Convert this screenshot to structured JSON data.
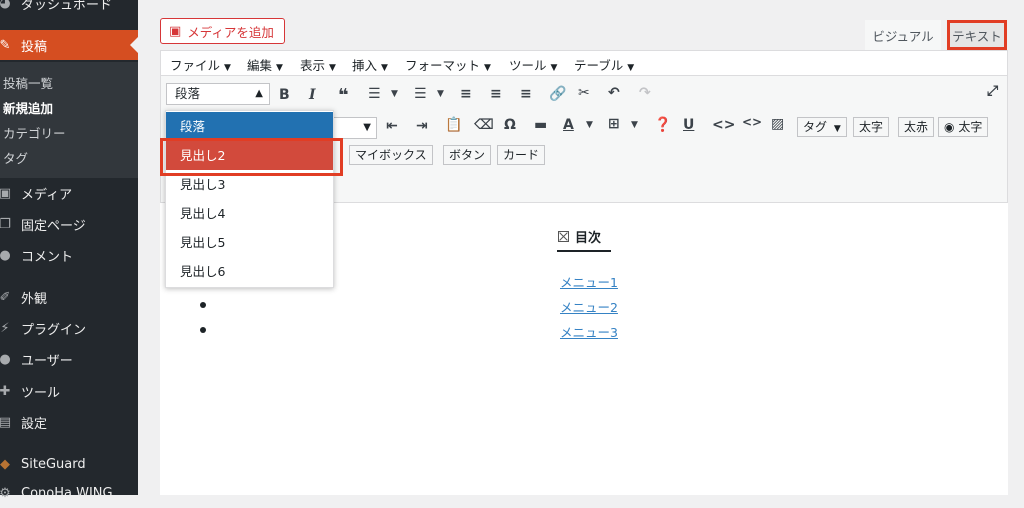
{
  "sidebar": {
    "items": [
      {
        "label": "ダッシュボード",
        "icon": "dashboard-icon"
      },
      {
        "label": "投稿",
        "icon": "pin-icon"
      },
      {
        "label": "メディア",
        "icon": "media-icon"
      },
      {
        "label": "固定ページ",
        "icon": "pages-icon"
      },
      {
        "label": "コメント",
        "icon": "comment-icon"
      },
      {
        "label": "外観",
        "icon": "brush-icon"
      },
      {
        "label": "プラグイン",
        "icon": "plugin-icon"
      },
      {
        "label": "ユーザー",
        "icon": "user-icon"
      },
      {
        "label": "ツール",
        "icon": "wrench-icon"
      },
      {
        "label": "設定",
        "icon": "settings-icon"
      },
      {
        "label": "SiteGuard",
        "icon": "shield-icon"
      },
      {
        "label": "ConoHa WING",
        "icon": "gear-icon"
      }
    ],
    "submenu": [
      "投稿一覧",
      "新規追加",
      "カテゴリー",
      "タグ"
    ]
  },
  "editor": {
    "add_media_label": "メディアを追加",
    "tab_visual": "ビジュアル",
    "tab_text": "テキスト",
    "menubar": [
      "ファイル",
      "編集",
      "表示",
      "挿入",
      "フォーマット",
      "ツール",
      "テーブル"
    ],
    "format_value": "段落",
    "buttons": [
      "タグ",
      "太字",
      "太赤",
      "太字",
      "マイボックス",
      "ボタン",
      "カード"
    ]
  },
  "dropdown": {
    "options": [
      "段落",
      "見出し2",
      "見出し3",
      "見出し4",
      "見出し5",
      "見出し6"
    ]
  },
  "content": {
    "toc_title": "目次",
    "toc_links": [
      "メニュー1",
      "メニュー2",
      "メニュー3"
    ]
  },
  "colors": {
    "sidebar_bg": "#23282d",
    "active": "#d54e21",
    "selected": "#2271b1",
    "highlight": "#e13d24",
    "link": "#3582c4"
  }
}
